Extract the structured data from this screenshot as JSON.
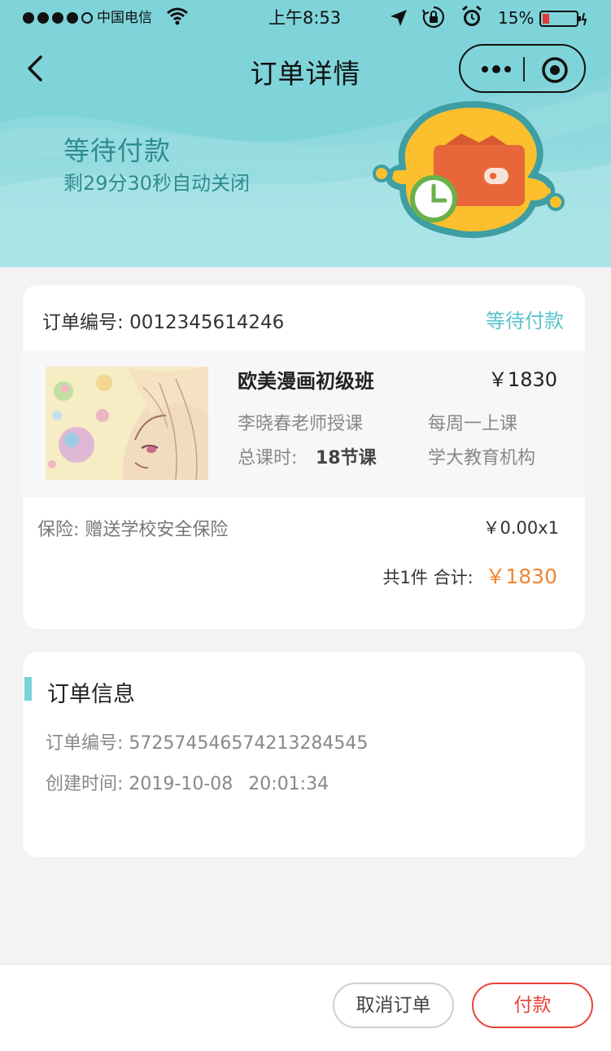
{
  "status_bar": {
    "carrier": "中国电信",
    "time": "上午8:53",
    "battery": "15%"
  },
  "nav": {
    "title": "订单详情"
  },
  "hero": {
    "status": "等待付款",
    "countdown": "剩29分30秒自动关闭"
  },
  "order": {
    "number_label": "订单编号:",
    "number": "0012345614246",
    "status": "等待付款",
    "product": {
      "title": "欧美漫画初级班",
      "price": "￥1830",
      "teacher": "李晓春老师授课",
      "schedule": "每周一上课",
      "hours_label": "总课时:",
      "hours_value": "18节课",
      "org": "学大教育机构"
    },
    "insurance_label": "保险:",
    "insurance": "赠送学校安全保险",
    "insurance_price": "￥0.00x1",
    "summary_count": "共1件",
    "summary_label": "合计:",
    "summary_total": "￥1830"
  },
  "order_info": {
    "title": "订单信息",
    "number_label": "订单编号:",
    "number": "572574546574213284545",
    "created_label": "创建时间:",
    "created_date": "2019-10-08",
    "created_time": "20:01:34"
  },
  "actions": {
    "cancel": "取消订单",
    "pay": "付款"
  },
  "colors": {
    "accent": "#5bc4cc",
    "hero_bg": "#79d2d8",
    "total": "#f08532",
    "pay": "#e8433a"
  }
}
